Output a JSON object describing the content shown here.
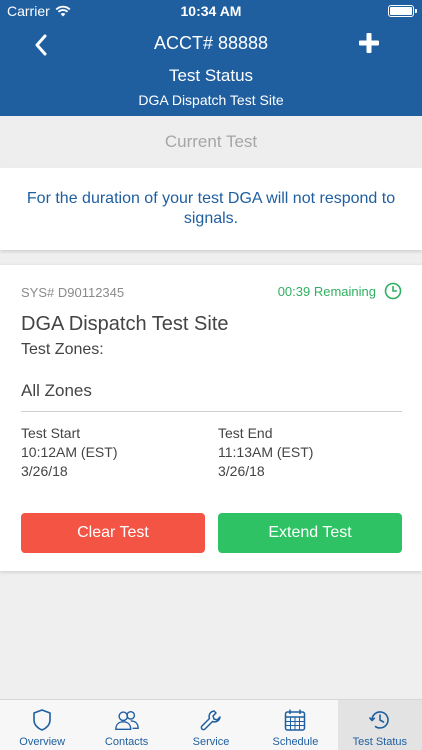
{
  "status_bar": {
    "carrier": "Carrier",
    "time": "10:34 AM"
  },
  "nav": {
    "title": "ACCT# 88888",
    "subtitle": "Test Status",
    "site": "DGA Dispatch Test Site"
  },
  "section_label": "Current Test",
  "notice": "For the duration of your test DGA will not respond to signals.",
  "card": {
    "sys": "SYS# D90112345",
    "remaining": "00:39 Remaining",
    "site_name": "DGA Dispatch Test Site",
    "zones_label": "Test Zones:",
    "zones_value": "All Zones",
    "start": {
      "label": "Test Start",
      "time": "10:12AM (EST)",
      "date": "3/26/18"
    },
    "end": {
      "label": "Test End",
      "time": "11:13AM (EST)",
      "date": "3/26/18"
    },
    "clear_label": "Clear Test",
    "extend_label": "Extend Test"
  },
  "tabs": [
    {
      "label": "Overview",
      "icon": "shield-icon"
    },
    {
      "label": "Contacts",
      "icon": "contacts-icon"
    },
    {
      "label": "Service",
      "icon": "wrench-icon"
    },
    {
      "label": "Schedule",
      "icon": "calendar-icon"
    },
    {
      "label": "Test Status",
      "icon": "clock-refresh-icon"
    }
  ],
  "colors": {
    "brand": "#1f5fa0",
    "clear": "#f45443",
    "extend": "#2fc264",
    "remaining": "#2fb060"
  }
}
